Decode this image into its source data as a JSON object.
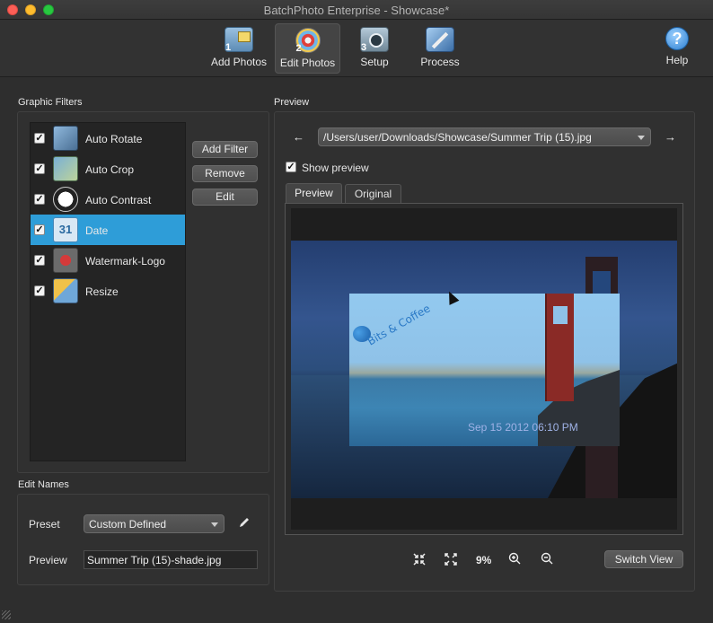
{
  "window": {
    "title": "BatchPhoto Enterprise - Showcase*"
  },
  "toolbar": {
    "items": [
      {
        "step": "1",
        "label": "Add Photos",
        "icon": "add-photos-icon"
      },
      {
        "step": "2",
        "label": "Edit Photos",
        "icon": "edit-photos-icon",
        "active": true
      },
      {
        "step": "3",
        "label": "Setup",
        "icon": "setup-icon"
      },
      {
        "label": "Process",
        "icon": "process-icon"
      }
    ],
    "help": {
      "label": "Help",
      "glyph": "?",
      "icon": "help-icon"
    }
  },
  "filters": {
    "section_title": "Graphic Filters",
    "items": [
      {
        "label": "Auto Rotate",
        "checked": "✓",
        "icon": "auto-rotate-icon"
      },
      {
        "label": "Auto Crop",
        "checked": "✓",
        "icon": "auto-crop-icon"
      },
      {
        "label": "Auto Contrast",
        "checked": "✓",
        "icon": "auto-contrast-icon"
      },
      {
        "label": "Date",
        "checked": "✓",
        "icon": "calendar-icon",
        "icon_text": "31",
        "selected": true
      },
      {
        "label": "Watermark-Logo",
        "checked": "✓",
        "icon": "watermark-icon"
      },
      {
        "label": "Resize",
        "checked": "✓",
        "icon": "resize-icon"
      }
    ],
    "buttons": {
      "add": "Add Filter",
      "remove": "Remove",
      "edit": "Edit"
    }
  },
  "edit_names": {
    "section_title": "Edit Names",
    "preset_label": "Preset",
    "preset_value": "Custom Defined",
    "preview_label": "Preview",
    "preview_value": "Summer Trip (15)-shade.jpg"
  },
  "preview": {
    "section_title": "Preview",
    "prev_glyph": "←",
    "next_glyph": "→",
    "file_path": "/Users/user/Downloads/Showcase/Summer Trip (15).jpg",
    "show_preview_label": "Show preview",
    "show_preview_checked": "✓",
    "tabs": [
      "Preview",
      "Original"
    ],
    "active_tab": "Preview",
    "watermark_text": "Bits & Coffee",
    "date_stamp": "Sep 15 2012 06:10 PM",
    "zoom_level": "9%",
    "switch_view_label": "Switch View"
  },
  "colors": {
    "selection": "#2e9dd8",
    "background": "#2e2e2e"
  }
}
